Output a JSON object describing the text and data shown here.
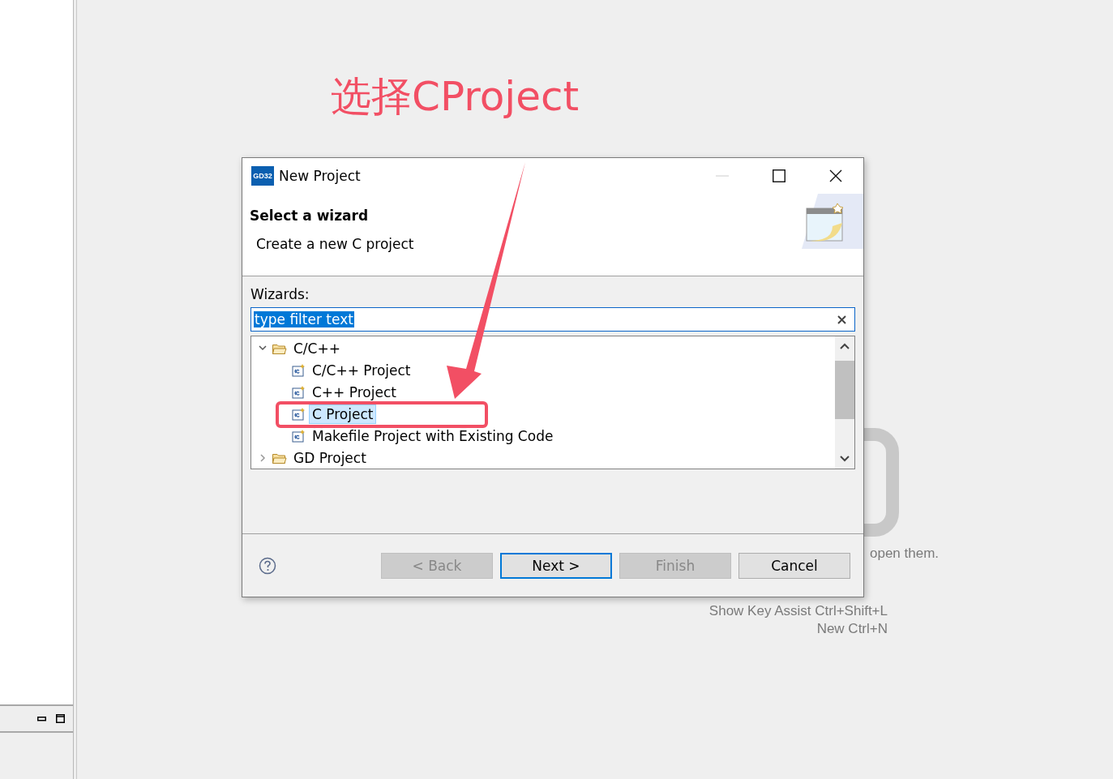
{
  "annotation": {
    "text": "选择CProject"
  },
  "background": {
    "hints": [
      {
        "text": "open them."
      },
      {
        "text": "Show Key Assist  Ctrl+Shift+L"
      },
      {
        "text": "New  Ctrl+N"
      }
    ]
  },
  "dialog": {
    "title": "New Project",
    "app_badge": "GD32",
    "header": {
      "title": "Select a wizard",
      "description": "Create a new C project"
    },
    "filter": {
      "label": "Wizards:",
      "value": "type filter text",
      "selected": true
    },
    "tree": [
      {
        "label": "C/C++",
        "expanded": true,
        "selected": false,
        "children": [
          {
            "label": "C/C++ Project",
            "selected": false
          },
          {
            "label": "C++ Project",
            "selected": false
          },
          {
            "label": "C Project",
            "selected": true
          },
          {
            "label": "Makefile Project with Existing Code",
            "selected": false
          }
        ]
      },
      {
        "label": "GD Project",
        "expanded": false,
        "selected": false
      }
    ],
    "buttons": [
      {
        "label": "< Back",
        "disabled": true,
        "default": false
      },
      {
        "label": "Next >",
        "disabled": false,
        "default": true
      },
      {
        "label": "Finish",
        "disabled": true,
        "default": false
      },
      {
        "label": "Cancel",
        "disabled": false,
        "default": false
      }
    ]
  }
}
